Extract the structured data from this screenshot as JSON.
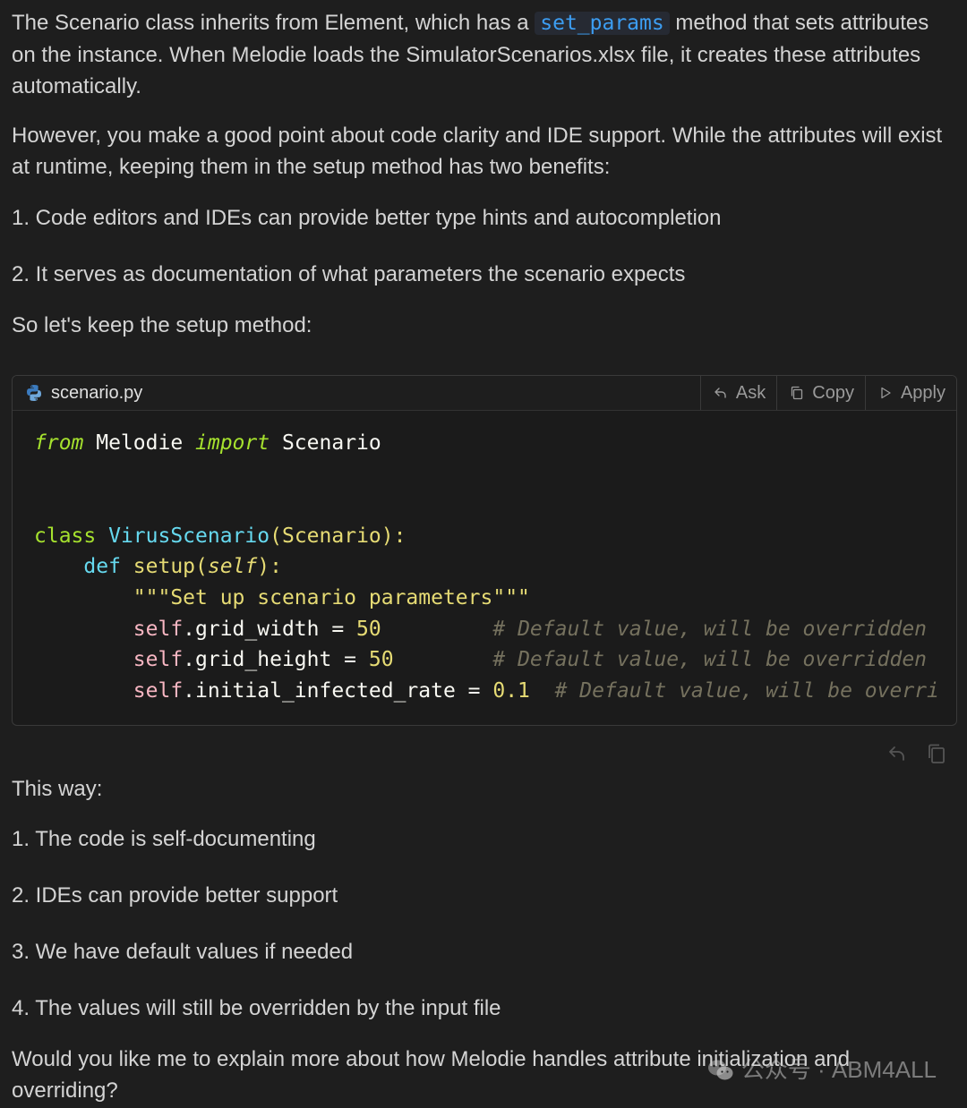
{
  "intro": {
    "p1_before": "The Scenario class inherits from Element, which has a ",
    "p1_code": "set_params",
    "p1_after": " method that sets attributes on the instance. When Melodie loads the SimulatorScenarios.xlsx file, it creates these attributes automatically.",
    "p2": "However, you make a good point about code clarity and IDE support. While the attributes will exist at runtime, keeping them in the setup method has two benefits:",
    "benefits": [
      "1. Code editors and IDEs can provide better type hints and autocompletion",
      "2. It serves as documentation of what parameters the scenario expects"
    ],
    "lead": "So let's keep the setup method:"
  },
  "codeblock": {
    "filename": "scenario.py",
    "file_icon": "python-icon",
    "actions": [
      {
        "label": "Ask",
        "icon": "reply-arrow-icon"
      },
      {
        "label": "Copy",
        "icon": "copy-icon"
      },
      {
        "label": "Apply",
        "icon": "play-triangle-icon"
      }
    ],
    "code": {
      "l1_from": "from",
      "l1_mod": " Melodie ",
      "l1_import": "import",
      "l1_name": " Scenario",
      "l4_class": "class",
      "l4_name": " VirusScenario",
      "l4_open": "(",
      "l4_base": "Scenario",
      "l4_close": "):",
      "l5_indent": "    ",
      "l5_def": "def",
      "l5_name": " setup",
      "l5_open": "(",
      "l5_self": "self",
      "l5_close": "):",
      "l6_indent": "        ",
      "l6_doc": "\"\"\"Set up scenario parameters\"\"\"",
      "l7_indent": "        ",
      "l7_self": "self",
      "l7_attr": ".grid_width = ",
      "l7_num": "50",
      "l7_pad": "         ",
      "l7_cmt": "# Default value, will be overridden b",
      "l8_indent": "        ",
      "l8_self": "self",
      "l8_attr": ".grid_height = ",
      "l8_num": "50",
      "l8_pad": "        ",
      "l8_cmt": "# Default value, will be overridden b",
      "l9_indent": "        ",
      "l9_self": "self",
      "l9_attr": ".initial_infected_rate = ",
      "l9_num": "0.1",
      "l9_pad": "  ",
      "l9_cmt": "# Default value, will be overri"
    }
  },
  "below_actions": [
    "reply-icon",
    "copy-icon"
  ],
  "outro": {
    "lead": "This way:",
    "points": [
      "1. The code is self-documenting",
      "2. IDEs can provide better support",
      "3. We have default values if needed",
      "4. The values will still be overridden by the input file"
    ],
    "question": "Would you like me to explain more about how Melodie handles attribute initialization and overriding?"
  },
  "watermark": {
    "icon": "wechat-icon",
    "text": "公众号 · ABM4ALL"
  }
}
